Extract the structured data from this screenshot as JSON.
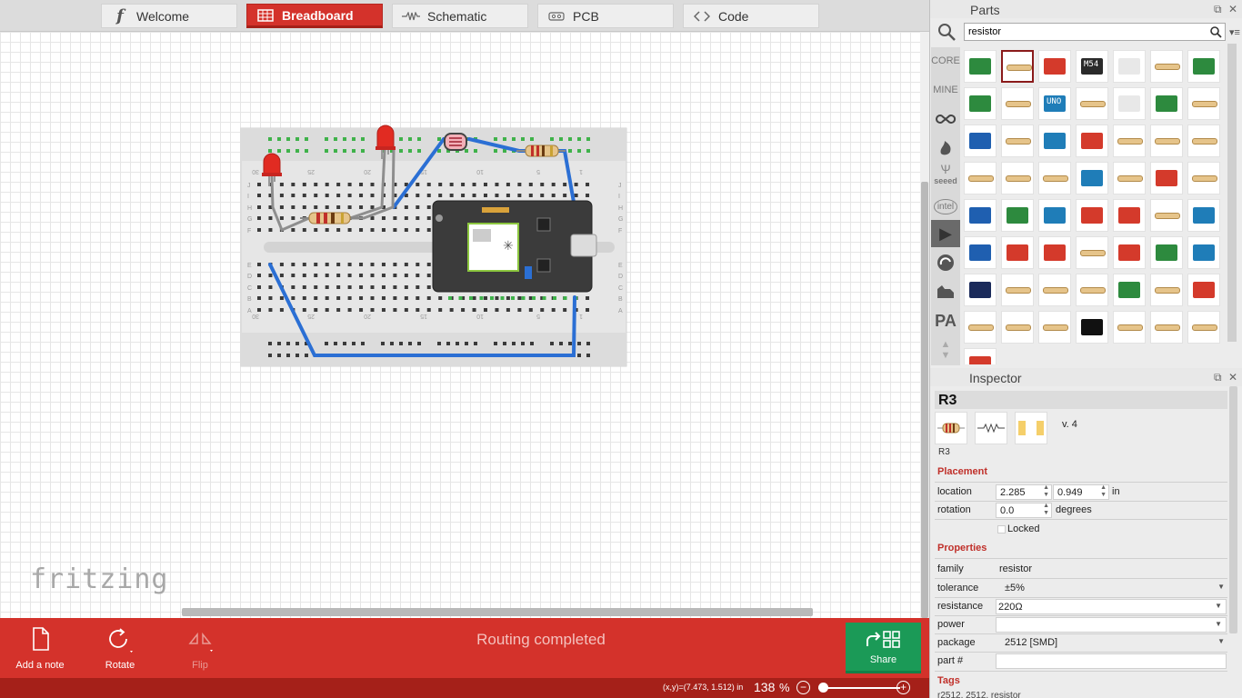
{
  "tabs": [
    {
      "label": "Welcome",
      "icon": "fritzing-f-icon",
      "active": false
    },
    {
      "label": "Breadboard",
      "icon": "breadboard-icon",
      "active": true
    },
    {
      "label": "Schematic",
      "icon": "resistor-symbol-icon",
      "active": false
    },
    {
      "label": "PCB",
      "icon": "pcb-icon",
      "active": false
    },
    {
      "label": "Code",
      "icon": "code-brackets-icon",
      "active": false
    }
  ],
  "canvas": {
    "logo_text": "fritzing",
    "breadboard_row_letters_top": [
      "J",
      "I",
      "H",
      "G",
      "F"
    ],
    "breadboard_row_letters_bottom": [
      "E",
      "D",
      "C",
      "B",
      "A"
    ],
    "breadboard_column_numbers": [
      "30",
      "25",
      "20",
      "15",
      "10",
      "5",
      "1"
    ],
    "wire_colors": {
      "blue": "#2b6fd4",
      "gray": "#8e8e8e"
    },
    "led_color": "#e12b22"
  },
  "toolbar": {
    "add_note": "Add a note",
    "rotate": "Rotate",
    "flip": "Flip",
    "share": "Share",
    "routing_status": "Routing completed"
  },
  "status": {
    "coords": "(x,y)=(7.473, 1.512) in",
    "zoom": "138",
    "zoom_unit": "%"
  },
  "parts": {
    "title": "Parts",
    "search_value": "resistor",
    "bins": [
      "CORE",
      "MINE",
      "arduino-icon",
      "sparkfun-flame-icon",
      "seeed",
      "intel",
      "play-icon",
      "snootlab-icon",
      "adafruit-icon",
      "PA",
      "arrows-icon"
    ],
    "bin_labels": {
      "core": "CORE",
      "mine": "MINE",
      "seeed": "seeed",
      "intel": "intel",
      "pa": "PA"
    },
    "m54_label": "M54",
    "uno_label": "UNO"
  },
  "inspector": {
    "title": "Inspector",
    "part_name": "R3",
    "version": "v. 4",
    "title_field": "R3",
    "placement_header": "Placement",
    "location_label": "location",
    "location_x": "2.285",
    "location_y": "0.949",
    "location_unit": "in",
    "rotation_label": "rotation",
    "rotation_value": "0.0",
    "rotation_unit": "degrees",
    "locked_label": "Locked",
    "properties_header": "Properties",
    "family_label": "family",
    "family_value": "resistor",
    "tolerance_label": "tolerance",
    "tolerance_value": "±5%",
    "resistance_label": "resistance",
    "resistance_value": "220Ω",
    "power_label": "power",
    "power_value": "",
    "package_label": "package",
    "package_value": "2512 [SMD]",
    "partnum_label": "part #",
    "partnum_value": "",
    "tags_header": "Tags",
    "tags_value": "r2512, 2512, resistor"
  }
}
